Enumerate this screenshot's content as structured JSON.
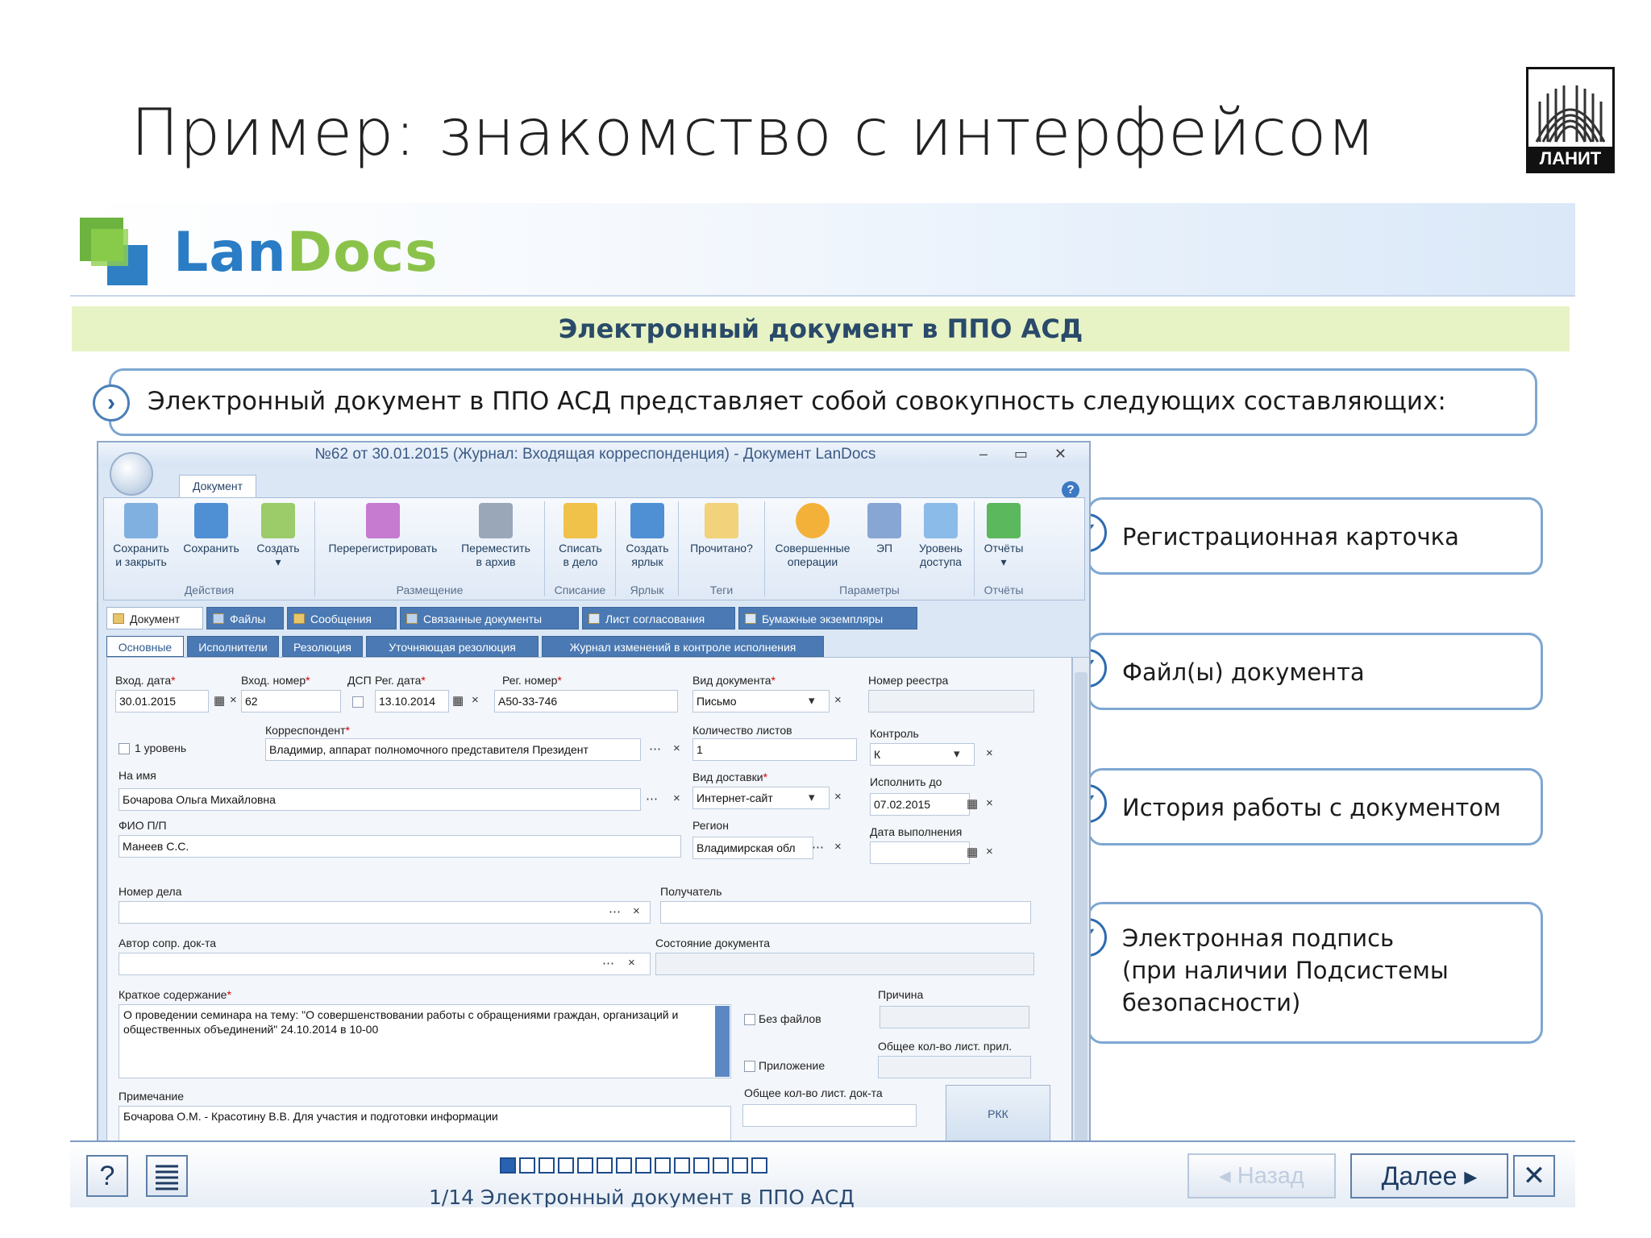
{
  "slide": {
    "title": "Пример: знакомство с интерфейсом",
    "logo_text": "ЛАНИТ"
  },
  "app": {
    "brand_part1": "Lan",
    "brand_part2": "Docs",
    "section_title": "Электронный документ в ППО АСД",
    "intro": "Электронный документ в ППО АСД представляет собой совокупность следующих составляющих:"
  },
  "callouts": [
    {
      "line1": "Регистрационная карточка"
    },
    {
      "line1": "Файл(ы) документа"
    },
    {
      "line1": "История работы с документом"
    },
    {
      "line1": "Электронная подпись",
      "line2": "(при наличии Подсистемы",
      "line3": "безопасности)"
    }
  ],
  "window": {
    "title": "№62 от 30.01.2015 (Журнал: Входящая корреспонденция) - Документ LanDocs",
    "controls": "–  ▭  ✕",
    "ribbon_tab": "Документ",
    "help": "?",
    "groups": [
      "Действия",
      "Размещение",
      "Списание",
      "Ярлык",
      "Теги",
      "Параметры",
      "Отчёты"
    ],
    "buttons": [
      {
        "l1": "Сохранить",
        "l2": "и закрыть"
      },
      {
        "l1": "Сохранить",
        "l2": ""
      },
      {
        "l1": "Создать",
        "l2": "▾"
      },
      {
        "l1": "Перерегистрировать",
        "l2": ""
      },
      {
        "l1": "Переместить",
        "l2": "в архив"
      },
      {
        "l1": "Списать",
        "l2": "в дело"
      },
      {
        "l1": "Создать",
        "l2": "ярлык"
      },
      {
        "l1": "Прочитано?",
        "l2": ""
      },
      {
        "l1": "Совершенные",
        "l2": "операции"
      },
      {
        "l1": "ЭП",
        "l2": ""
      },
      {
        "l1": "Уровень",
        "l2": "доступа"
      },
      {
        "l1": "Отчёты",
        "l2": "▾"
      }
    ],
    "tabs1": [
      "Документ",
      "Файлы",
      "Сообщения",
      "Связанные документы",
      "Лист согласования",
      "Бумажные экземпляры"
    ],
    "tabs2": [
      "Основные",
      "Исполнители",
      "Резолюция",
      "Уточняющая резолюция",
      "Журнал изменений в контроле исполнения"
    ]
  },
  "form": {
    "in_date_label": "Вход. дата",
    "in_date": "30.01.2015",
    "in_num_label": "Вход. номер",
    "in_num": "62",
    "dsp_label": "ДСП",
    "reg_date_label": "Рег. дата",
    "reg_date": "13.10.2014",
    "reg_num_label": "Рег. номер",
    "reg_num": "А50-33-746",
    "doc_type_label": "Вид документа",
    "doc_type": "Письмо",
    "registry_label": "Номер реестра",
    "level_label": "1 уровень",
    "correspondent_label": "Корреспондент",
    "correspondent": "Владимир, аппарат полномочного представителя Президент",
    "sheets_label": "Количество листов",
    "sheets": "1",
    "control_label": "Контроль",
    "control": "К",
    "to_name_label": "На имя",
    "to_name": "Бочарова Ольга Михайловна",
    "delivery_label": "Вид доставки",
    "delivery": "Интернет-сайт",
    "due_label": "Исполнить до",
    "due": "07.02.2015",
    "signer_label": "ФИО П/П",
    "signer": "Манеев С.С.",
    "region_label": "Регион",
    "region": "Владимирская обл",
    "done_label": "Дата выполнения",
    "case_label": "Номер дела",
    "recipient_label": "Получатель",
    "author_label": "Автор сопр. док-та",
    "state_label": "Состояние документа",
    "summary_label": "Краткое содержание",
    "summary": "О проведении семинара на тему: \"О совершенствовании работы с обращениями граждан, организаций и общественных объединений\" 24.10.2014 в 10-00",
    "reason_label": "Причина",
    "no_files_label": "Без файлов",
    "attach_sheets_label": "Общее кол-во лист. прил.",
    "attachment_label": "Приложение",
    "note_label": "Примечание",
    "note": "Бочарова О.М. - Красотину В.В. Для участия и подготовки информации",
    "total_sheets_label": "Общее кол-во лист. док-та",
    "rkk": "РКК"
  },
  "nav": {
    "help": "?",
    "counter": "1/14 Электронный документ в ППО АСД",
    "back": "◂ Назад",
    "next": "Далее ▸",
    "close": "✕",
    "current_slide": 1,
    "total_slides": 14
  }
}
